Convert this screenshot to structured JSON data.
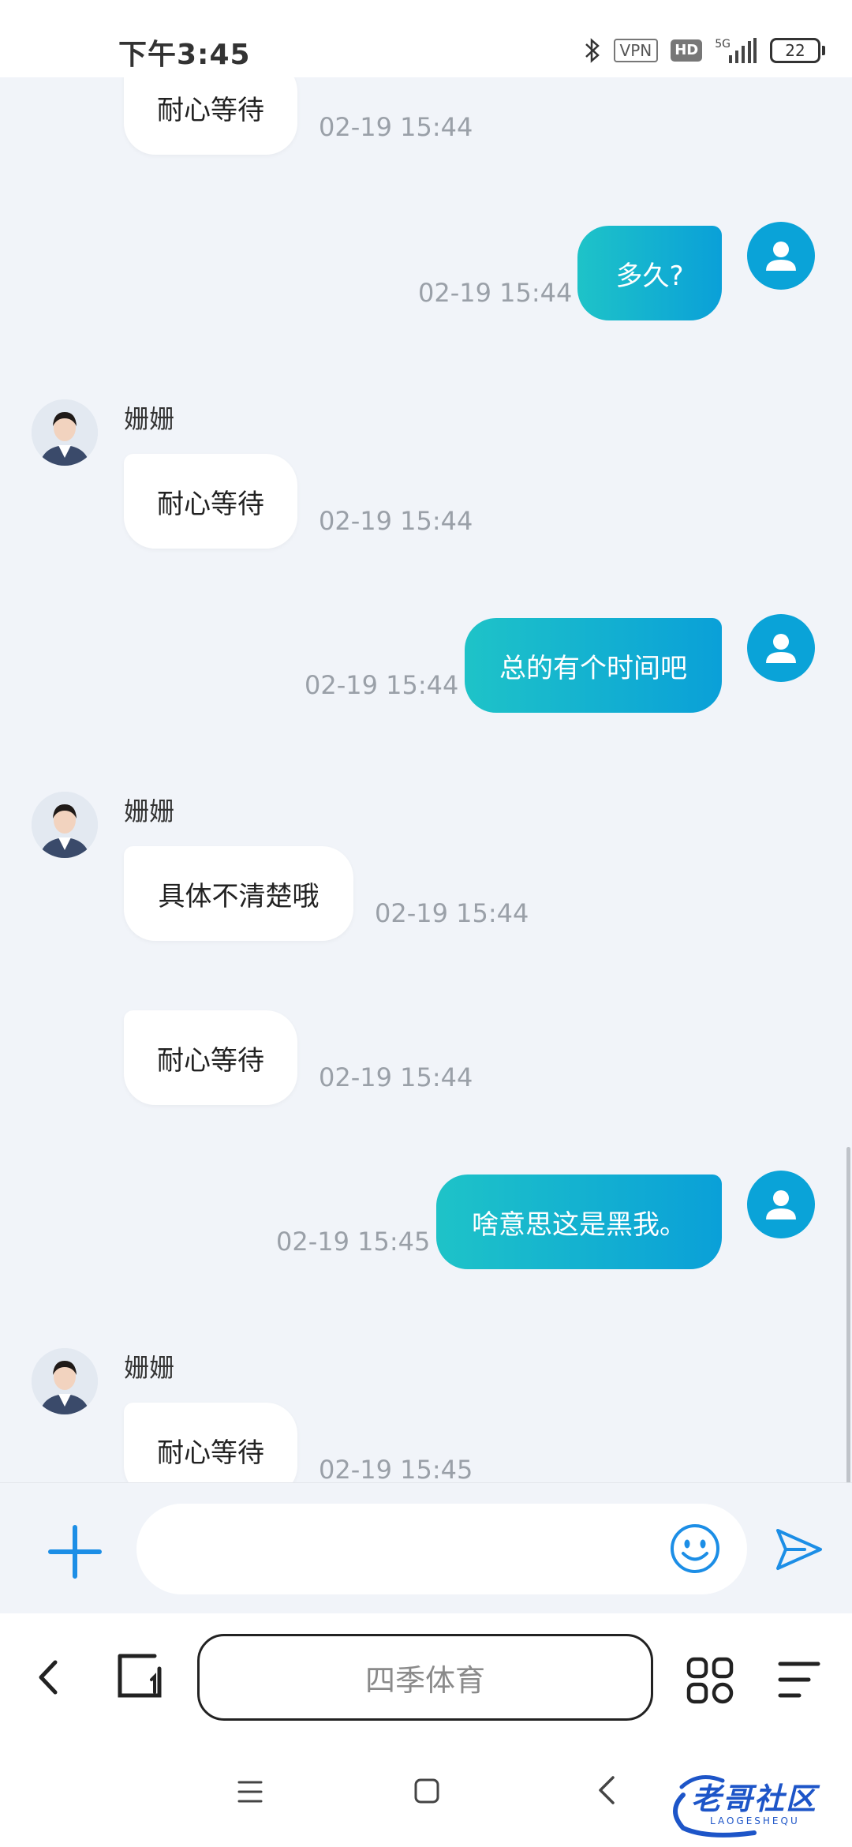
{
  "status_bar": {
    "time": "下午3:45",
    "vpn": "VPN",
    "hd": "HD",
    "network": "5G",
    "battery": "22"
  },
  "chat": {
    "agent_name": "姗姗",
    "messages": [
      {
        "side": "in",
        "text": "耐心等待",
        "time": "02-19 15:44"
      },
      {
        "side": "out",
        "text": "多久?",
        "time": "02-19 15:44"
      },
      {
        "side": "in",
        "sender": "姗姗",
        "text": "耐心等待",
        "time": "02-19 15:44"
      },
      {
        "side": "out",
        "text": "总的有个时间吧",
        "time": "02-19 15:44"
      },
      {
        "side": "in",
        "sender": "姗姗",
        "text": "具体不清楚哦",
        "time": "02-19 15:44"
      },
      {
        "side": "in",
        "text": "耐心等待",
        "time": "02-19 15:44"
      },
      {
        "side": "out",
        "text": "啥意思这是黑我。",
        "time": "02-19 15:45"
      },
      {
        "side": "in",
        "sender": "姗姗",
        "text": "耐心等待",
        "time": "02-19 15:45"
      }
    ]
  },
  "input": {
    "placeholder": ""
  },
  "browser": {
    "address_text": "四季体育"
  },
  "watermark": {
    "text": "老哥社区",
    "subtext": "LAOGESHEQU"
  },
  "colors": {
    "chat_bg": "#f1f4f9",
    "out_bubble_start": "#1ec3c8",
    "out_bubble_end": "#0aa0d8",
    "accent": "#0aa3d8",
    "timestamp": "#9aa0a8"
  }
}
